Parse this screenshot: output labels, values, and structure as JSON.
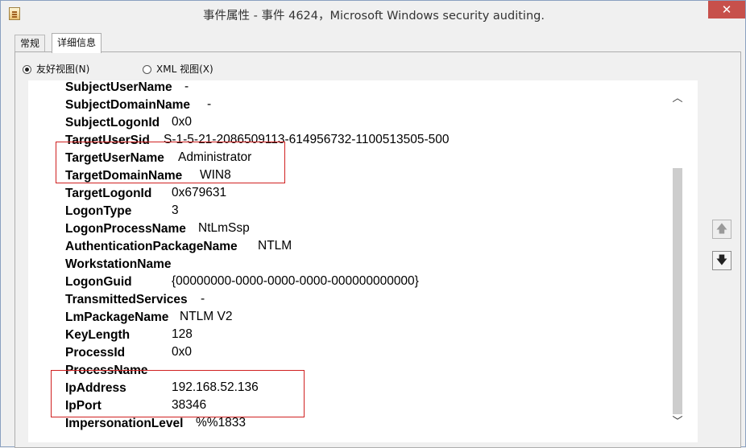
{
  "window": {
    "title": "事件属性 - 事件 4624，Microsoft Windows security auditing.",
    "close_label": "✕",
    "icon": "event-properties-icon"
  },
  "tabs": [
    {
      "label": "常规",
      "selected": false
    },
    {
      "label": "详细信息",
      "selected": true
    }
  ],
  "view_options": {
    "friendly": {
      "label": "友好视图(N)",
      "checked": true
    },
    "xml": {
      "label": "XML 视图(X)",
      "checked": false
    }
  },
  "details": [
    {
      "key": "SubjectUserName",
      "value": "-"
    },
    {
      "key": "SubjectDomainName",
      "value": "-"
    },
    {
      "key": "SubjectLogonId",
      "value": "0x0"
    },
    {
      "key": "TargetUserSid",
      "value": "S-1-5-21-2086509113-614956732-1100513505-500"
    },
    {
      "key": "TargetUserName",
      "value": "Administrator"
    },
    {
      "key": "TargetDomainName",
      "value": "WIN8"
    },
    {
      "key": "TargetLogonId",
      "value": "0x679631"
    },
    {
      "key": "LogonType",
      "value": "3"
    },
    {
      "key": "LogonProcessName",
      "value": "NtLmSsp"
    },
    {
      "key": "AuthenticationPackageName",
      "value": "NTLM"
    },
    {
      "key": "WorkstationName",
      "value": ""
    },
    {
      "key": "LogonGuid",
      "value": "{00000000-0000-0000-0000-000000000000}"
    },
    {
      "key": "TransmittedServices",
      "value": "-"
    },
    {
      "key": "LmPackageName",
      "value": "NTLM V2"
    },
    {
      "key": "KeyLength",
      "value": "128"
    },
    {
      "key": "ProcessId",
      "value": "0x0"
    },
    {
      "key": "ProcessName",
      "value": ""
    },
    {
      "key": "IpAddress",
      "value": "192.168.52.136"
    },
    {
      "key": "IpPort",
      "value": "38346"
    },
    {
      "key": "ImpersonationLevel",
      "value": "%%1833"
    }
  ],
  "scrollbar": {
    "up_icon": "chevron-up-icon",
    "down_icon": "chevron-down-icon",
    "up_glyph": "︿",
    "down_glyph": "﹀"
  },
  "side_buttons": {
    "previous_icon": "arrow-up-icon",
    "next_icon": "arrow-down-icon",
    "previous_glyph": "🡅",
    "next_glyph": "🡇"
  },
  "colors": {
    "highlight_border": "#d02020",
    "close_button": "#c7504b"
  }
}
